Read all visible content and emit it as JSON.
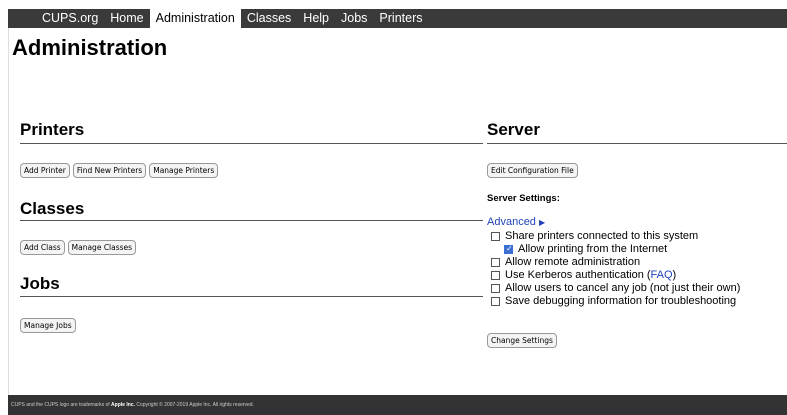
{
  "nav": {
    "items": [
      {
        "label": "CUPS.org"
      },
      {
        "label": "Home"
      },
      {
        "label": "Administration"
      },
      {
        "label": "Classes"
      },
      {
        "label": "Help"
      },
      {
        "label": "Jobs"
      },
      {
        "label": "Printers"
      }
    ],
    "active": "Administration"
  },
  "page": {
    "title": "Administration"
  },
  "printers": {
    "heading": "Printers",
    "buttons": [
      "Add Printer",
      "Find New Printers",
      "Manage Printers"
    ]
  },
  "classes": {
    "heading": "Classes",
    "buttons": [
      "Add Class",
      "Manage Classes"
    ]
  },
  "jobs": {
    "heading": "Jobs",
    "buttons": [
      "Manage Jobs"
    ]
  },
  "server": {
    "heading": "Server",
    "edit_button": "Edit Configuration File",
    "settings_label": "Server Settings:",
    "advanced": "Advanced",
    "options": [
      {
        "label": "Share printers connected to this system",
        "checked": false
      },
      {
        "label": "Allow printing from the Internet",
        "checked": true
      },
      {
        "label": "Allow remote administration",
        "checked": false
      },
      {
        "label": "Use Kerberos authentication (",
        "link": "FAQ",
        "suffix": ")",
        "checked": false
      },
      {
        "label": "Allow users to cancel any job (not just their own)",
        "checked": false
      },
      {
        "label": "Save debugging information for troubleshooting",
        "checked": false
      }
    ],
    "change_button": "Change Settings"
  },
  "footer": {
    "pre": "CUPS and the CUPS logo are trademarks of ",
    "bold": "Apple Inc.",
    "post": " Copyright © 2007-2019 Apple Inc. All rights reserved."
  },
  "colors": {
    "navbar": "#3a3a3a",
    "link": "#2244bb",
    "checkbox_checked": "#3b6fd4",
    "footer": "#333333"
  }
}
